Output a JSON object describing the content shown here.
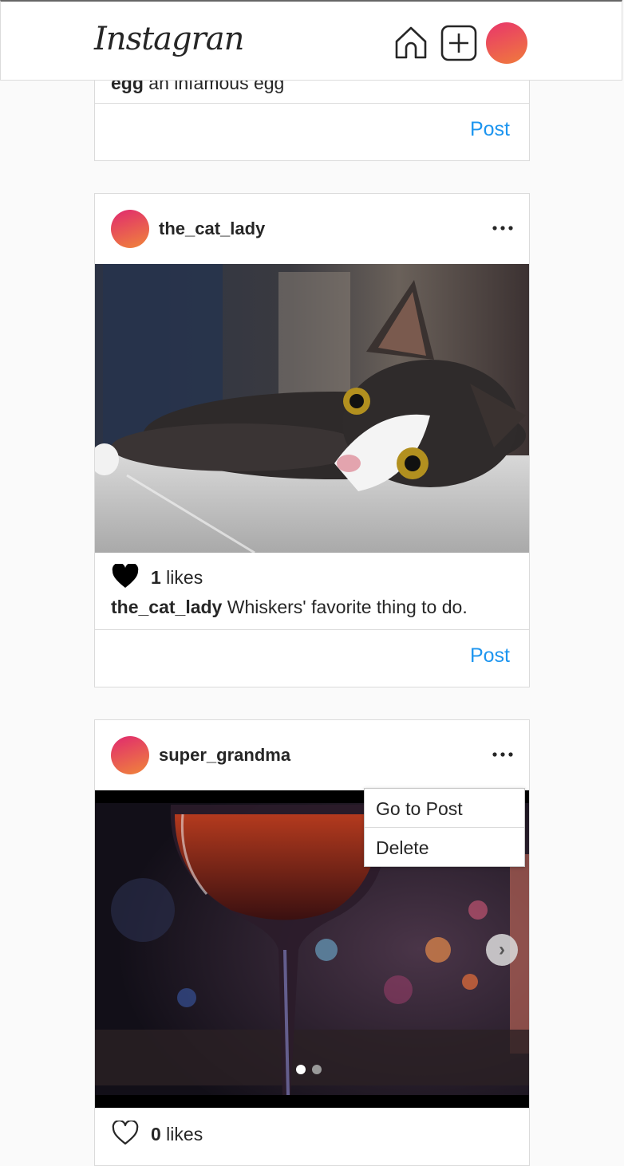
{
  "header": {
    "logo_text": "Instagran"
  },
  "posts": [
    {
      "caption_user": "egg",
      "caption_text": " an infamous egg",
      "post_label": "Post"
    },
    {
      "username": "the_cat_lady",
      "likes_count": "1",
      "likes_label": " likes",
      "liked": true,
      "caption_user": "the_cat_lady",
      "caption_text": " Whiskers' favorite thing to do.",
      "post_label": "Post"
    },
    {
      "username": "super_grandma",
      "likes_count": "0",
      "likes_label": " likes",
      "liked": false,
      "carousel_total": 2,
      "carousel_active": 1
    }
  ],
  "context_menu": {
    "items": [
      "Go to Post",
      "Delete"
    ]
  },
  "colors": {
    "accent_link": "#1d95ef",
    "avatar_gradient_start": "#e0296f",
    "avatar_gradient_end": "#f0863a"
  },
  "icons": {
    "home": "home-icon",
    "new_post": "plus-square-icon",
    "more": "more-dots-icon",
    "like_filled": "heart-filled-icon",
    "like_outline": "heart-outline-icon",
    "next": "chevron-right-icon"
  }
}
